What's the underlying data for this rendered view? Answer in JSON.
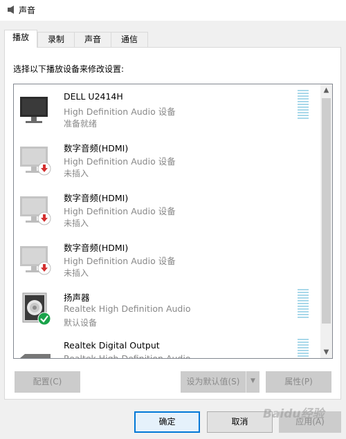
{
  "window": {
    "title": "声音",
    "icon": "speaker-icon"
  },
  "tabs": [
    {
      "label": "播放",
      "active": true
    },
    {
      "label": "录制",
      "active": false
    },
    {
      "label": "声音",
      "active": false
    },
    {
      "label": "通信",
      "active": false
    }
  ],
  "instruction": "选择以下播放设备来修改设置:",
  "devices": [
    {
      "name": "DELL U2414H",
      "description": "High Definition Audio 设备",
      "status": "准备就绪",
      "icon": "monitor-icon",
      "badge": "none",
      "level_meter": true
    },
    {
      "name": "数字音频(HDMI)",
      "description": "High Definition Audio 设备",
      "status": "未插入",
      "icon": "monitor-icon",
      "badge": "unplugged-arrow-icon",
      "level_meter": false
    },
    {
      "name": "数字音频(HDMI)",
      "description": "High Definition Audio 设备",
      "status": "未插入",
      "icon": "monitor-icon",
      "badge": "unplugged-arrow-icon",
      "level_meter": false
    },
    {
      "name": "数字音频(HDMI)",
      "description": "High Definition Audio 设备",
      "status": "未插入",
      "icon": "monitor-icon",
      "badge": "unplugged-arrow-icon",
      "level_meter": false
    },
    {
      "name": "扬声器",
      "description": "Realtek High Definition Audio",
      "status": "默认设备",
      "icon": "speaker-icon",
      "badge": "default-check-icon",
      "level_meter": true
    },
    {
      "name": "Realtek Digital Output",
      "description": "Realtek High Definition Audio",
      "status": "",
      "icon": "digital-output-icon",
      "badge": "none",
      "level_meter": true
    }
  ],
  "buttons": {
    "configure": "配置(C)",
    "set_default": "设为默认值(S)",
    "properties": "属性(P)",
    "ok": "确定",
    "cancel": "取消",
    "apply": "应用(A)"
  },
  "watermark": "Baidu经验",
  "colors": {
    "accent": "#0078d7",
    "check_badge": "#1aa34a",
    "unplugged_badge": "#d32f2f",
    "meter": "#a8d8ea"
  }
}
